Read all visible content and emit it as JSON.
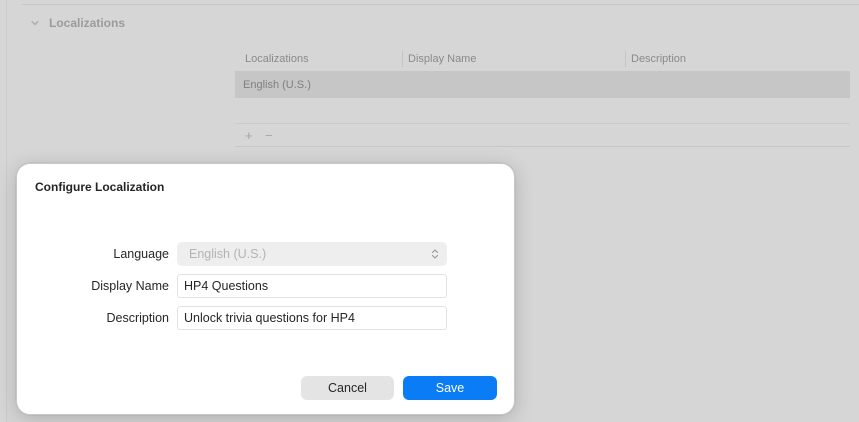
{
  "background": {
    "section": {
      "title": "Localizations",
      "expanded": true
    },
    "table": {
      "columns": [
        "Localizations",
        "Display Name",
        "Description"
      ],
      "rows": [
        {
          "localization": "English (U.S.)",
          "display_name": "",
          "description": "",
          "selected": true
        }
      ],
      "footer": {
        "add_label": "+",
        "remove_label": "−"
      }
    }
  },
  "sheet": {
    "title": "Configure Localization",
    "language": {
      "label": "Language",
      "value": "English (U.S.)",
      "disabled": true
    },
    "display_name": {
      "label": "Display Name",
      "value": "HP4 Questions"
    },
    "description": {
      "label": "Description",
      "value": "Unlock trivia questions for HP4"
    },
    "buttons": {
      "cancel": "Cancel",
      "save": "Save"
    }
  },
  "colors": {
    "accent": "#0a7cf6",
    "dim_background": "#d6d6d6",
    "sheet_background": "#ffffff"
  },
  "icons": {
    "disclosure": "chevron-down-icon",
    "popup": "updown-chevron-icon"
  }
}
